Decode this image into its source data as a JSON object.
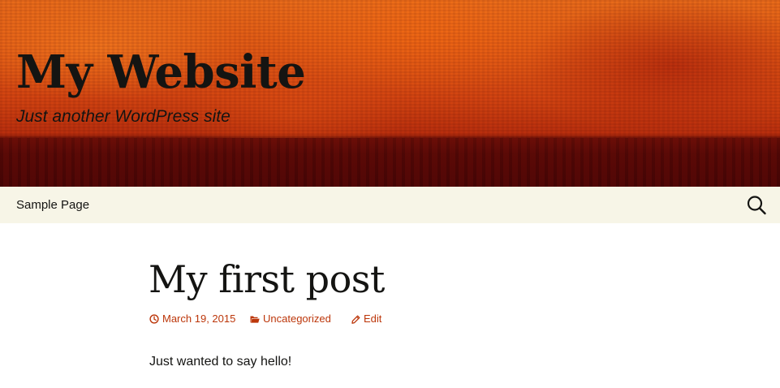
{
  "header": {
    "site_title": "My Website",
    "site_description": "Just another WordPress site",
    "title_color": "#141412"
  },
  "nav": {
    "items": [
      {
        "label": "Sample Page"
      }
    ],
    "background": "#f7f5e7",
    "search_icon": "search-icon"
  },
  "post": {
    "title": "My first post",
    "meta": {
      "date": "March 19, 2015",
      "date_icon": "clock-icon",
      "category": "Uncategorized",
      "category_icon": "folder-icon",
      "edit": "Edit",
      "edit_icon": "pencil-icon",
      "link_color": "#bc360a"
    },
    "content": "Just wanted to say hello!"
  }
}
